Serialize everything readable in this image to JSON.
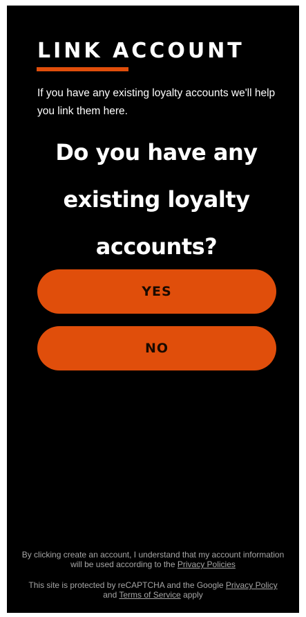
{
  "header": {
    "title": "LINK ACCOUNT",
    "intro": "If you have any existing loyalty accounts we'll help you link them here."
  },
  "question": {
    "text": "Do you have any existing loyalty accounts?"
  },
  "buttons": {
    "yes_label": "YES",
    "no_label": "NO"
  },
  "legal": {
    "consent_text": "By clicking create an account, I understand that my account information will be used according to the",
    "privacy_policies_link": "Privacy Policies",
    "recaptcha_text": "This site is protected by reCAPTCHA and the Google",
    "privacy_policy_link": "Privacy Policy",
    "and_text": "and",
    "terms_link": "Terms of Service",
    "apply_text": "apply"
  },
  "colors": {
    "accent": "#e04e0b",
    "background": "#000000",
    "text": "#ffffff",
    "muted_text": "#a6a6a6"
  }
}
